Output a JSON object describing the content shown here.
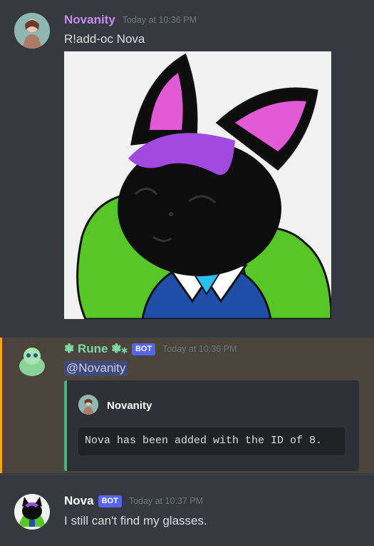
{
  "messages": [
    {
      "username": "Novanity",
      "timestamp": "Today at 10:36 PM",
      "text": "R!add-oc Nova",
      "username_color": "#c48ef1"
    },
    {
      "username": "❃ Rune ❃⁎",
      "badge": "BOT",
      "timestamp": "Today at 10:36 PM",
      "mention": "@Novanity",
      "embed": {
        "author": "Novanity",
        "code": "Nova has been added with the ID of 8."
      },
      "highlight_color": "#faa81a",
      "embed_color": "#43b581"
    },
    {
      "username": "Nova",
      "badge": "BOT",
      "timestamp": "Today at 10:37 PM",
      "text": "I still can't find my glasses."
    }
  ],
  "colors": {
    "background": "#36393f",
    "bot_badge": "#5865f2",
    "mention_bg": "#424a73"
  }
}
